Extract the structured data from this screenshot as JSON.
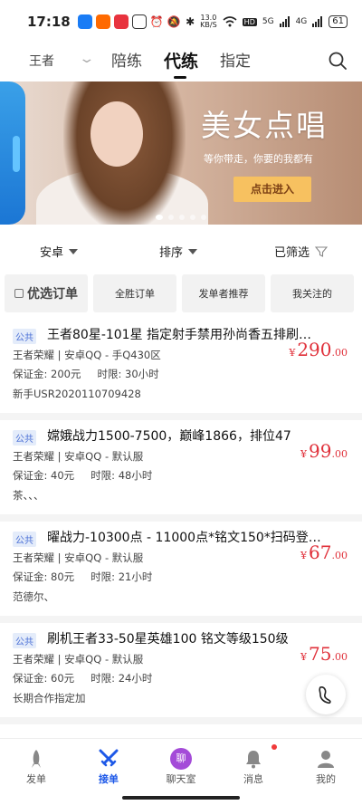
{
  "status_bar": {
    "time": "17:18",
    "speed_value": "13.0",
    "speed_unit": "KB/S",
    "hd": "HD",
    "signal1": "5G",
    "signal2": "4G",
    "battery": "61"
  },
  "top_nav": {
    "game_filter": "王者",
    "tabs": [
      {
        "label": "陪练"
      },
      {
        "label": "代练"
      },
      {
        "label": "指定"
      }
    ],
    "active_tab": "代练"
  },
  "banner": {
    "title": "美女点唱",
    "subtitle": "等你带走，你要的我都有",
    "button": "点击进入",
    "dot_count": 5,
    "active_dot": 0
  },
  "filters": {
    "platform": "安卓",
    "sort": "排序",
    "screened": "已筛选"
  },
  "quick_buttons": {
    "preferred": "优选订单",
    "win_all": "全胜订单",
    "recommended": "发单者推荐",
    "following": "我关注的"
  },
  "orders": [
    {
      "tag": "公共",
      "title": "王者80星-101星 指定射手禁用孙尚香五排刷…",
      "meta": "王者荣耀 | 安卓QQ - 手Q430区",
      "deposit": "保证金: 200元",
      "limit": "时限: 30小时",
      "note": "新手USR2020110709428",
      "price_symbol": "¥",
      "price_int": "290",
      "price_dec": ".00"
    },
    {
      "tag": "公共",
      "title": "嫦娥战力1500-7500，巅峰1866，排位47",
      "meta": "王者荣耀 | 安卓QQ - 默认服",
      "deposit": "保证金: 40元",
      "limit": "时限: 48小时",
      "note": "茶、、、",
      "price_symbol": "¥",
      "price_int": "99",
      "price_dec": ".00"
    },
    {
      "tag": "公共",
      "title": "曜战力-10300点 - 11000点*铭文150*扫码登…",
      "meta": "王者荣耀 | 安卓QQ - 默认服",
      "deposit": "保证金: 80元",
      "limit": "时限: 21小时",
      "note": "范德尔、",
      "price_symbol": "¥",
      "price_int": "67",
      "price_dec": ".00"
    },
    {
      "tag": "公共",
      "title": "刷机王者33-50星英雄100 铭文等级150级",
      "meta": "王者荣耀 | 安卓QQ - 默认服",
      "deposit": "保证金: 60元",
      "limit": "时限: 24小时",
      "note": "长期合作指定加",
      "price_symbol": "¥",
      "price_int": "75",
      "price_dec": ".00"
    }
  ],
  "bottom_nav": {
    "items": [
      {
        "label": "发单",
        "icon": "rocket-icon"
      },
      {
        "label": "接单",
        "icon": "crossed-swords-icon"
      },
      {
        "label": "聊天室",
        "icon": "chat-badge-icon",
        "badge": "聊"
      },
      {
        "label": "消息",
        "icon": "bell-icon"
      },
      {
        "label": "我的",
        "icon": "person-icon"
      }
    ],
    "active": "接单"
  },
  "colors": {
    "accent_blue": "#1e59e8",
    "price_red": "#e0303a",
    "tag_bg": "#e4ecfa",
    "tag_text": "#4a6fd6",
    "banner_button": "#f7c160"
  }
}
